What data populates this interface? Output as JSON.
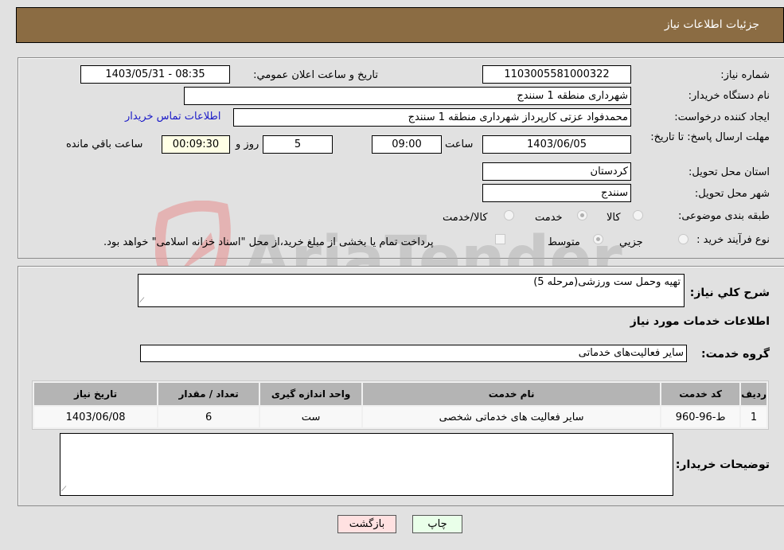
{
  "header": {
    "title": "جزئیات اطلاعات نیاز"
  },
  "fields": {
    "need_number": {
      "label": "شماره نیاز:",
      "value": "1103005581000322"
    },
    "announce_datetime": {
      "label": "تاريخ و ساعت اعلان عمومي:",
      "value": "1403/05/31 - 08:35"
    },
    "buyer_org": {
      "label": "نام دستگاه خريدار:",
      "value": "شهرداری منطقه 1 سنندج"
    },
    "requester": {
      "label": "ايجاد کننده درخواست:",
      "value": "محمدفواد عزتی کارپرداز شهرداری منطقه 1 سنندج"
    },
    "buyer_contact_link": "اطلاعات تماس خريدار",
    "deadline": {
      "label": "مهلت ارسال پاسخ: تا تاریخ:",
      "date": "1403/06/05",
      "time_label": "ساعت",
      "time": "09:00",
      "days": "5",
      "days_label": "روز و",
      "remaining": "00:09:30",
      "remaining_label": "ساعت باقي مانده"
    },
    "province": {
      "label": "استان محل تحویل:",
      "value": "کردستان"
    },
    "city": {
      "label": "شهر محل تحویل:",
      "value": "سنندج"
    },
    "category": {
      "label": "طبقه بندی موضوعی:",
      "options": [
        {
          "label": "کالا",
          "checked": false
        },
        {
          "label": "خدمت",
          "checked": true
        },
        {
          "label": "کالا/خدمت",
          "checked": false
        }
      ]
    },
    "purchase_type": {
      "label": "نوع فرآيند خريد :",
      "options": [
        {
          "label": "جزيي",
          "checked": false
        },
        {
          "label": "متوسط",
          "checked": true
        }
      ],
      "treasury_checkbox_label": "پرداخت تمام يا بخشی از مبلغ خريد،از محل \"اسناد خزانه اسلامی\" خواهد بود.",
      "treasury_checked": false
    }
  },
  "description": {
    "label": "شرح کلي نياز:",
    "value": "تهيه وحمل ست ورزشی(مرحله 5)"
  },
  "services_section_title": "اطلاعات خدمات مورد نياز",
  "service_group": {
    "label": "گروه خدمت:",
    "value": "ساير فعاليت‌های خدماتی"
  },
  "table": {
    "headers": [
      "رديف",
      "کد خدمت",
      "نام خدمت",
      "واحد اندازه گيری",
      "تعداد / مقدار",
      "تاريخ نياز"
    ],
    "rows": [
      [
        "1",
        "ط-96-960",
        "ساير فعاليت های خدماتی شخصی",
        "ست",
        "6",
        "1403/06/08"
      ]
    ]
  },
  "buyer_notes": {
    "label": "توضيحات خريدار:",
    "value": ""
  },
  "buttons": {
    "print": "چاپ",
    "back": "بازگشت"
  },
  "watermark": {
    "text": "AriaTender.neT",
    "brand_color": "#e6a0a0"
  }
}
